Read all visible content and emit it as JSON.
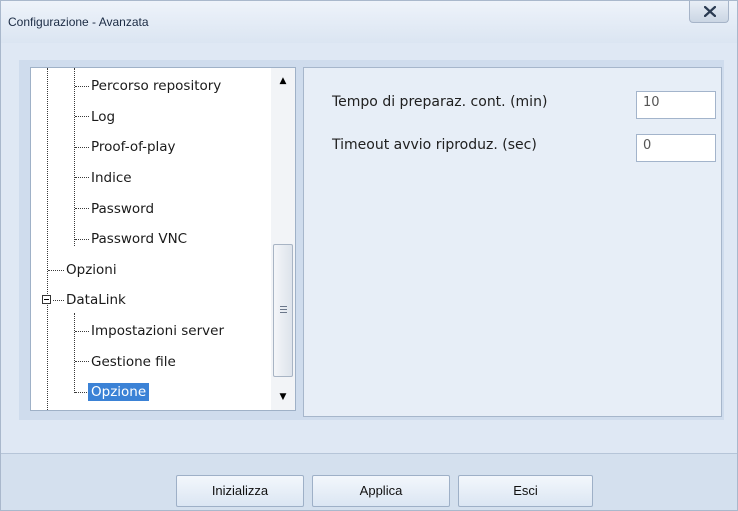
{
  "window": {
    "title": "Configurazione - Avanzata"
  },
  "tree": {
    "items": [
      {
        "label": "Percorso repository"
      },
      {
        "label": "Log"
      },
      {
        "label": "Proof-of-play"
      },
      {
        "label": "Indice"
      },
      {
        "label": "Password"
      },
      {
        "label": "Password VNC"
      },
      {
        "label": "Opzioni"
      },
      {
        "label": "DataLink"
      },
      {
        "label": "Impostazioni server"
      },
      {
        "label": "Gestione file"
      },
      {
        "label": "Opzione",
        "selected": true
      }
    ]
  },
  "settings": {
    "fields": [
      {
        "label": "Tempo di preparaz. cont. (min)",
        "value": "10"
      },
      {
        "label": "Timeout avvio riproduz. (sec)",
        "value": "0"
      }
    ]
  },
  "buttons": {
    "initialize": "Inizializza",
    "apply": "Applica",
    "exit": "Esci"
  },
  "colors": {
    "selection": "#3b82d6",
    "dialog_bg": "#dfe8f4"
  }
}
